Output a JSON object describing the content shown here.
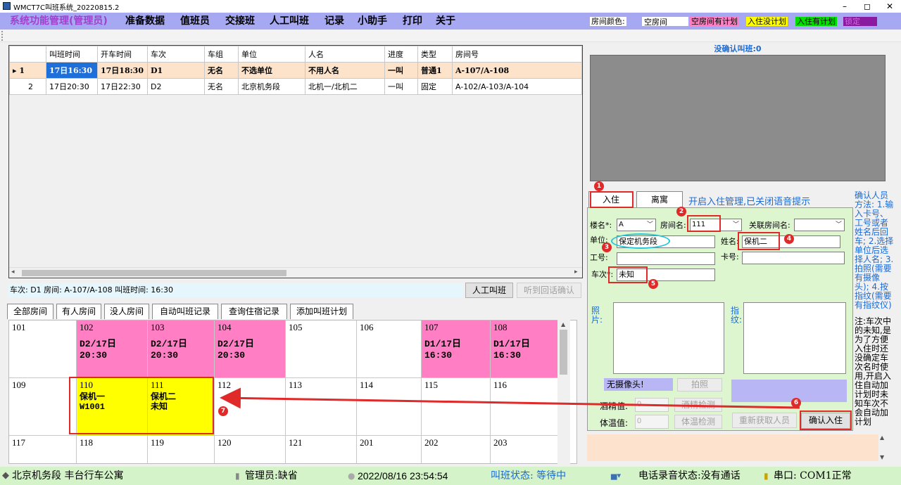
{
  "window": {
    "title": "WMCT7C叫班系统_20220815.2",
    "min": "–",
    "max": "◻",
    "close": "✕"
  },
  "menu": [
    "系统功能管理(管理员)",
    "准备数据",
    "值班员",
    "交接班",
    "人工叫班",
    "记录",
    "小助手",
    "打印",
    "关于"
  ],
  "legend": {
    "label": "房间颜色:",
    "items": [
      {
        "text": "空房间",
        "color": "#ffffff"
      },
      {
        "text": "空房间有计划",
        "color": "#ff7ec4"
      },
      {
        "text": "入住没计划",
        "color": "#ffff00"
      },
      {
        "text": "入住有计划",
        "color": "#00dd00"
      },
      {
        "text": "锁定",
        "color": "#8a1aa0"
      }
    ]
  },
  "grid": {
    "headers": [
      "",
      "叫班时间",
      "开车时间",
      "车次",
      "车组",
      "单位",
      "人名",
      "进度",
      "类型",
      "房间号"
    ],
    "rows": [
      [
        "▸ 1",
        "17日16:30",
        "17日18:30",
        "D1",
        "无名",
        "不选单位",
        "不用人名",
        "一叫",
        "普通1",
        "A-107/A-108"
      ],
      [
        "2",
        "17日20:30",
        "17日22:30",
        "D2",
        "无名",
        "北京机务段",
        "北机一/北机二",
        "一叫",
        "固定",
        "A-102/A-103/A-104"
      ]
    ]
  },
  "info": {
    "text": "车次: D1 房间: A-107/A-108  叫班时间: 16:30",
    "manual_call": "人工叫班",
    "listen": "听到回话确认"
  },
  "tabs": [
    "全部房间",
    "有人房间",
    "没人房间",
    "自动叫班记录",
    "查询住宿记录",
    "添加叫班计划"
  ],
  "rooms": [
    {
      "num": "101",
      "color": "#ffffff"
    },
    {
      "num": "102",
      "color": "#ff7ec4",
      "plan": "D2/17日",
      "time": "20:30"
    },
    {
      "num": "103",
      "color": "#ff7ec4",
      "plan": "D2/17日",
      "time": "20:30"
    },
    {
      "num": "104",
      "color": "#ff7ec4",
      "plan": "D2/17日",
      "time": "20:30"
    },
    {
      "num": "105",
      "color": "#ffffff"
    },
    {
      "num": "106",
      "color": "#ffffff"
    },
    {
      "num": "107",
      "color": "#ff7ec4",
      "plan": "D1/17日",
      "time": "16:30"
    },
    {
      "num": "108",
      "color": "#ff7ec4",
      "plan": "D1/17日",
      "time": "16:30"
    },
    {
      "num": "109",
      "color": "#ffffff"
    },
    {
      "num": "110",
      "color": "#ffff00",
      "person": "保机一",
      "extra": "W1001"
    },
    {
      "num": "111",
      "color": "#ffff00",
      "person": "保机二",
      "extra": "未知"
    },
    {
      "num": "112",
      "color": "#ffffff"
    },
    {
      "num": "113",
      "color": "#ffffff"
    },
    {
      "num": "114",
      "color": "#ffffff"
    },
    {
      "num": "115",
      "color": "#ffffff"
    },
    {
      "num": "116",
      "color": "#ffffff"
    },
    {
      "num": "117",
      "color": "#ffffff"
    },
    {
      "num": "118",
      "color": "#ffffff"
    },
    {
      "num": "119",
      "color": "#ffffff"
    },
    {
      "num": "120",
      "color": "#ffffff"
    },
    {
      "num": "121",
      "color": "#ffffff"
    },
    {
      "num": "201",
      "color": "#ffffff"
    },
    {
      "num": "202",
      "color": "#ffffff"
    },
    {
      "num": "203",
      "color": "#ffffff"
    }
  ],
  "right": {
    "unconfirmed": "没确认叫班:0",
    "tab_checkin": "入住",
    "tab_checkout": "离寓",
    "notice": "开启入住管理,已关闭语音提示",
    "building_label": "楼名*:",
    "building": "A",
    "room_label": "房间名:",
    "room": "111",
    "linked_label": "关联房间名:",
    "linked": "",
    "unit_label": "单位:",
    "unit": "保定机务段",
    "name_label": "姓名:",
    "name": "保机二",
    "workno_label": "工号:",
    "workno": "",
    "card_label": "卡号:",
    "card": "",
    "train_label": "车次*:",
    "train": "未知",
    "photo_label": "照片:",
    "finger_label": "指纹:",
    "no_camera": "无摄像头!",
    "take_photo": "拍照",
    "alcohol_label": "酒精值:",
    "alcohol": "0",
    "alcohol_btn": "酒精检测",
    "temp_label": "体温值:",
    "temp": "0",
    "temp_btn": "体温检测",
    "reacquire": "重新获取人员",
    "confirm": "确认入住"
  },
  "sidenote": {
    "blue": "确认人员方法: 1.输入卡号、工号或者姓名后回车; 2.选择单位后选择人名; 3.拍照(需要有摄像头); 4.按指纹(需要有指纹仪)",
    "black": "注:车次中的未知,是为了方便入住时还没确定车次名时使用,开启入住自动加计划时未知车次不会自动加计划"
  },
  "status": {
    "location": "北京机务段 丰台行车公寓",
    "admin": "管理员:缺省",
    "datetime": "2022/08/16 23:54:54",
    "call_state": "叫班状态: 等待中",
    "phone": "电话录音状态:没有通话",
    "port": "串口: COM1正常"
  },
  "badges": [
    "1",
    "2",
    "3",
    "4",
    "5",
    "6",
    "7"
  ],
  "colors": {
    "menubar": "#a6a8f2",
    "panel": "#ddf6cf",
    "annotation": "#e02a2a",
    "status": "#d4f3c8"
  }
}
